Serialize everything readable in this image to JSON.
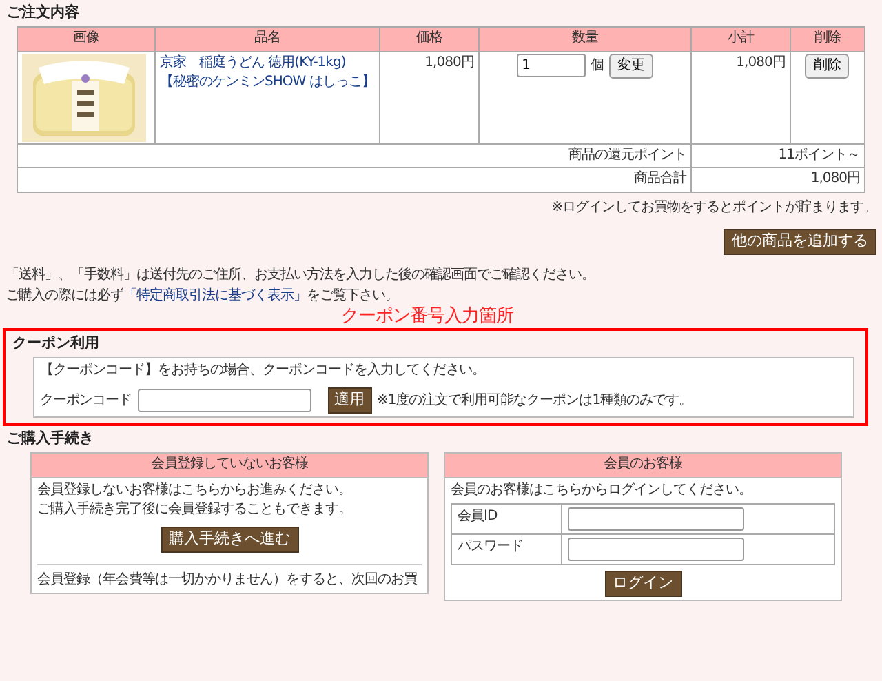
{
  "order": {
    "title": "ご注文内容",
    "columns": [
      "画像",
      "品名",
      "価格",
      "数量",
      "小計",
      "削除"
    ],
    "items": [
      {
        "name_lines": [
          "京家　稲庭うどん 徳用(KY-1kg)",
          "【秘密のケンミンSHOW はしっこ】"
        ],
        "price": "1,080円",
        "quantity": "1",
        "unit": "個",
        "change_button": "変更",
        "subtotal": "1,080円",
        "delete_button": "削除"
      }
    ],
    "summary": [
      {
        "label": "商品の還元ポイント",
        "value": "11ポイント～"
      },
      {
        "label": "商品合計",
        "value": "1,080円"
      }
    ],
    "login_note": "※ログインしてお買物をするとポイントが貯まります。",
    "add_button": "他の商品を追加する"
  },
  "notices": [
    {
      "text": "「送料」、「手数料」は送付先のご住所、お支払い方法を入力した後の確認画面でご確認ください。"
    },
    {
      "before": "ご購入の際には必ず",
      "link": "「特定商取引法に基づく表示」",
      "after": "をご覧下さい。"
    }
  ],
  "annotation": "クーポン番号入力箇所",
  "coupon": {
    "title": "クーポン利用",
    "intro": "【クーポンコード】をお持ちの場合、クーポンコードを入力してください。",
    "label": "クーポンコード",
    "apply_button": "適用",
    "note": "※1度の注文で利用可能なクーポンは1種類のみです。"
  },
  "purchase": {
    "title": "ご購入手続き",
    "guest": {
      "header": "会員登録していないお客様",
      "lines": [
        "会員登録しないお客様はこちらからお進みください。",
        "ご購入手続き完了後に会員登録することもできます。"
      ],
      "button": "購入手続きへ進む",
      "bottom_lines": [
        "会員登録（年会費等は一切かかりません）をすると、次回のお買"
      ]
    },
    "member": {
      "header": "会員のお客様",
      "intro": "会員のお客様はこちらからログインしてください。",
      "fields": [
        {
          "label": "会員ID"
        },
        {
          "label": "パスワード"
        }
      ],
      "button": "ログイン"
    }
  }
}
